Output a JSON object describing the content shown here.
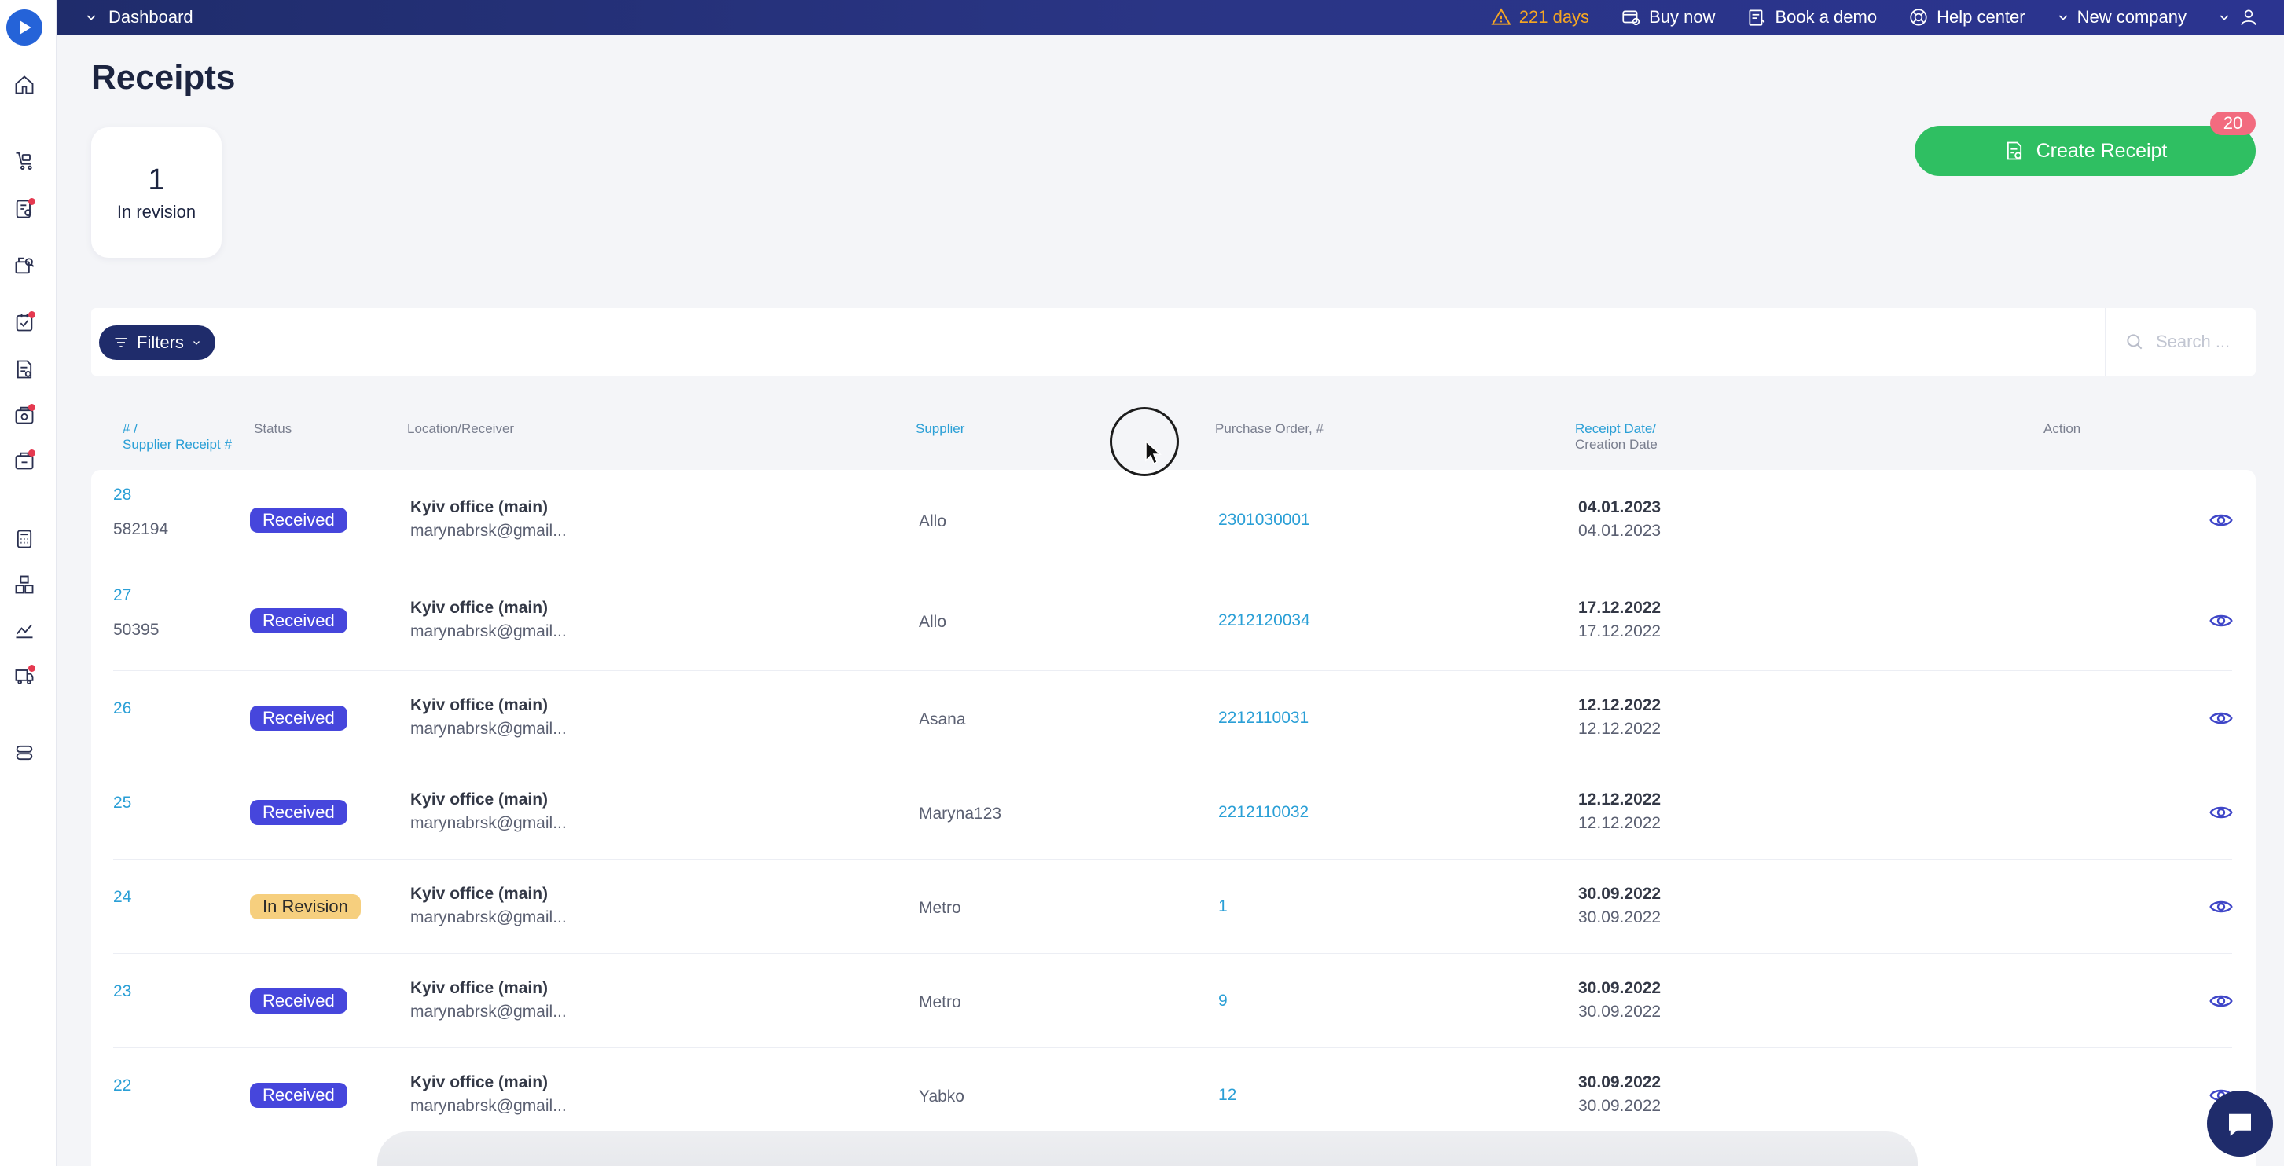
{
  "topbar": {
    "dashboard_label": "Dashboard",
    "trial_days": "221 days",
    "buy_now": "Buy now",
    "book_demo": "Book a demo",
    "help_center": "Help center",
    "company": "New company"
  },
  "page": {
    "title": "Receipts"
  },
  "stat": {
    "count": "1",
    "label": "In revision"
  },
  "actions": {
    "create_receipt": "Create Receipt",
    "badge": "20"
  },
  "filters": {
    "label": "Filters",
    "search_placeholder": "Search ..."
  },
  "columns": {
    "number_a": "# /",
    "number_b": "Supplier Receipt #",
    "status": "Status",
    "location": "Location/Receiver",
    "supplier": "Supplier",
    "purchase_order": "Purchase Order, #",
    "date_a": "Receipt Date/",
    "date_b": "Creation Date",
    "action": "Action"
  },
  "rows": [
    {
      "id": "28",
      "supplier_receipt": "582194",
      "status": "Received",
      "location": "Kyiv office (main)",
      "email": "marynabrsk@gmail...",
      "supplier": "Allo",
      "po": "2301030001",
      "receipt_date": "04.01.2023",
      "creation_date": "04.01.2023"
    },
    {
      "id": "27",
      "supplier_receipt": "50395",
      "status": "Received",
      "location": "Kyiv office (main)",
      "email": "marynabrsk@gmail...",
      "supplier": "Allo",
      "po": "2212120034",
      "receipt_date": "17.12.2022",
      "creation_date": "17.12.2022"
    },
    {
      "id": "26",
      "supplier_receipt": "",
      "status": "Received",
      "location": "Kyiv office (main)",
      "email": "marynabrsk@gmail...",
      "supplier": "Asana",
      "po": "2212110031",
      "receipt_date": "12.12.2022",
      "creation_date": "12.12.2022"
    },
    {
      "id": "25",
      "supplier_receipt": "",
      "status": "Received",
      "location": "Kyiv office (main)",
      "email": "marynabrsk@gmail...",
      "supplier": "Maryna123",
      "po": "2212110032",
      "receipt_date": "12.12.2022",
      "creation_date": "12.12.2022"
    },
    {
      "id": "24",
      "supplier_receipt": "",
      "status": "In Revision",
      "location": "Kyiv office (main)",
      "email": "marynabrsk@gmail...",
      "supplier": "Metro",
      "po": "1",
      "receipt_date": "30.09.2022",
      "creation_date": "30.09.2022"
    },
    {
      "id": "23",
      "supplier_receipt": "",
      "status": "Received",
      "location": "Kyiv office (main)",
      "email": "marynabrsk@gmail...",
      "supplier": "Metro",
      "po": "9",
      "receipt_date": "30.09.2022",
      "creation_date": "30.09.2022"
    },
    {
      "id": "22",
      "supplier_receipt": "",
      "status": "Received",
      "location": "Kyiv office (main)",
      "email": "marynabrsk@gmail...",
      "supplier": "Yabko",
      "po": "12",
      "receipt_date": "30.09.2022",
      "creation_date": "30.09.2022"
    }
  ],
  "colors": {
    "topbar": "#1f2c6b",
    "accent": "#2a9fd6",
    "create": "#2fbf62",
    "received": "#4646dc",
    "revision": "#f6cf7e",
    "badge": "#f26b7f"
  }
}
